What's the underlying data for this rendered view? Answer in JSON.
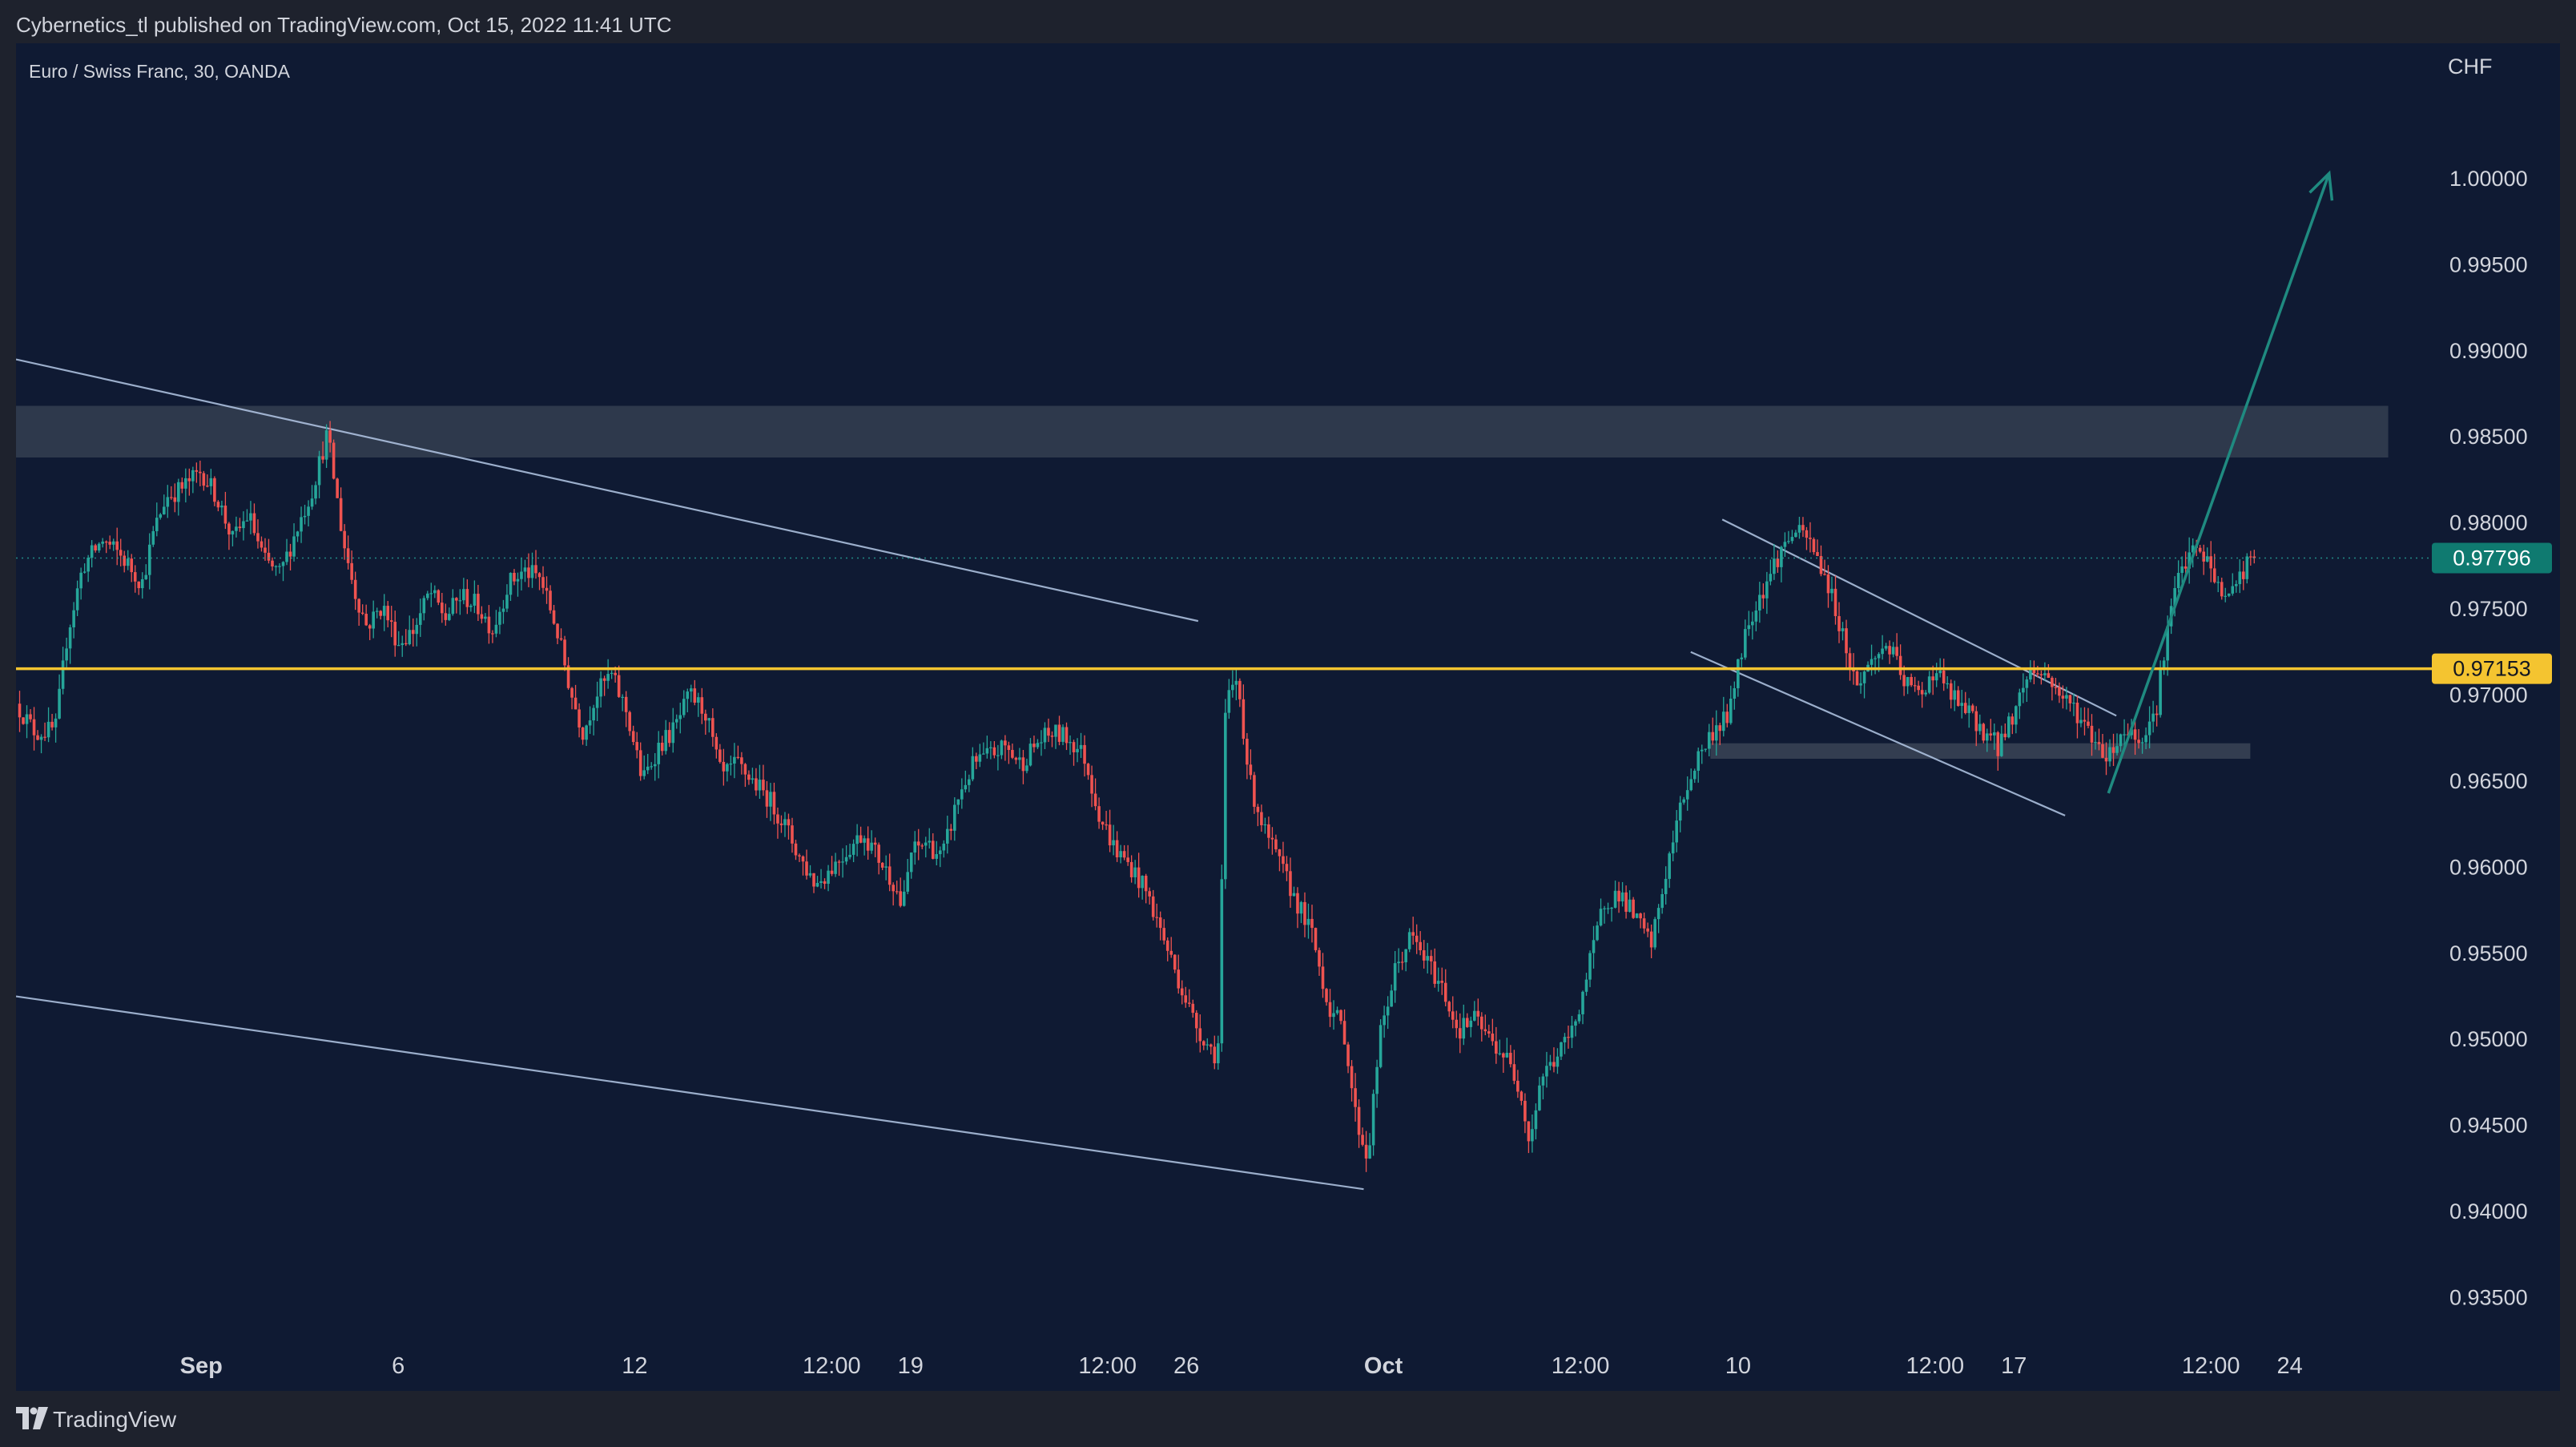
{
  "header": {
    "publish_line": "Cybernetics_tl published on TradingView.com, Oct 15, 2022 11:41 UTC"
  },
  "chart": {
    "symbol_title": "Euro / Swiss Franc, 30, OANDA",
    "currency_label": "CHF"
  },
  "footer": {
    "brand": "TradingView"
  },
  "colors": {
    "background": "#131722",
    "chart_bg": "#0f1a33",
    "bull": "#26a69a",
    "bear": "#ef5350",
    "support_line": "#f4c430",
    "last_price_badge": "#0f7a70",
    "zone_fill": "#3a4456",
    "trendline": "#b4c8e6",
    "arrow": "#1f8a80"
  },
  "chart_data": {
    "type": "candlestick",
    "title": "Euro / Swiss Franc, 30, OANDA",
    "ylabel": "CHF",
    "ylim": [
      0.932,
      1.006
    ],
    "y_ticks": [
      "1.00000",
      "0.99500",
      "0.99000",
      "0.98500",
      "0.98000",
      "0.97500",
      "0.97000",
      "0.96500",
      "0.96000",
      "0.95500",
      "0.95000",
      "0.94500",
      "0.94000",
      "0.93500"
    ],
    "y_tick_values": [
      1.0,
      0.995,
      0.99,
      0.985,
      0.98,
      0.975,
      0.97,
      0.965,
      0.96,
      0.955,
      0.95,
      0.945,
      0.94,
      0.935
    ],
    "x_ticks": [
      {
        "label": "Sep",
        "bold": true,
        "day": 0
      },
      {
        "label": "6",
        "bold": false,
        "day": 5
      },
      {
        "label": "12",
        "bold": false,
        "day": 11
      },
      {
        "label": "12:00",
        "bold": false,
        "day": 16
      },
      {
        "label": "19",
        "bold": false,
        "day": 18
      },
      {
        "label": "12:00",
        "bold": false,
        "day": 23
      },
      {
        "label": "26",
        "bold": false,
        "day": 25
      },
      {
        "label": "Oct",
        "bold": true,
        "day": 30
      },
      {
        "label": "12:00",
        "bold": false,
        "day": 35
      },
      {
        "label": "10",
        "bold": false,
        "day": 39
      },
      {
        "label": "12:00",
        "bold": false,
        "day": 44
      },
      {
        "label": "17",
        "bold": false,
        "day": 46
      },
      {
        "label": "12:00",
        "bold": false,
        "day": 51
      },
      {
        "label": "24",
        "bold": false,
        "day": 53
      }
    ],
    "x_range_days": [
      -4.7,
      56.2
    ],
    "price_path": [
      [
        -4.7,
        0.9695
      ],
      [
        -4.2,
        0.9678
      ],
      [
        -3.7,
        0.968
      ],
      [
        -3.4,
        0.9735
      ],
      [
        -3.0,
        0.9775
      ],
      [
        -2.5,
        0.979
      ],
      [
        -2.0,
        0.978
      ],
      [
        -1.5,
        0.9765
      ],
      [
        -1.2,
        0.9795
      ],
      [
        -0.9,
        0.9815
      ],
      [
        -0.5,
        0.982
      ],
      [
        0.0,
        0.983
      ],
      [
        0.4,
        0.9815
      ],
      [
        0.8,
        0.979
      ],
      [
        1.2,
        0.9805
      ],
      [
        1.6,
        0.9778
      ],
      [
        2.0,
        0.977
      ],
      [
        2.4,
        0.9795
      ],
      [
        2.8,
        0.9818
      ],
      [
        3.2,
        0.9852
      ],
      [
        3.6,
        0.979
      ],
      [
        3.9,
        0.976
      ],
      [
        4.2,
        0.974
      ],
      [
        4.6,
        0.9752
      ],
      [
        5.0,
        0.973
      ],
      [
        5.4,
        0.9738
      ],
      [
        5.8,
        0.976
      ],
      [
        6.2,
        0.9745
      ],
      [
        6.6,
        0.9758
      ],
      [
        7.0,
        0.9752
      ],
      [
        7.4,
        0.9738
      ],
      [
        7.8,
        0.9765
      ],
      [
        8.2,
        0.9772
      ],
      [
        8.6,
        0.9768
      ],
      [
        9.0,
        0.974
      ],
      [
        9.4,
        0.97
      ],
      [
        9.7,
        0.9678
      ],
      [
        10.0,
        0.97
      ],
      [
        10.4,
        0.9712
      ],
      [
        10.8,
        0.969
      ],
      [
        11.2,
        0.965
      ],
      [
        11.6,
        0.967
      ],
      [
        12.0,
        0.968
      ],
      [
        12.4,
        0.97
      ],
      [
        12.8,
        0.969
      ],
      [
        13.2,
        0.9652
      ],
      [
        13.6,
        0.966
      ],
      [
        14.0,
        0.965
      ],
      [
        14.4,
        0.964
      ],
      [
        14.8,
        0.9625
      ],
      [
        15.2,
        0.9605
      ],
      [
        15.6,
        0.959
      ],
      [
        16.0,
        0.96
      ],
      [
        16.4,
        0.961
      ],
      [
        16.8,
        0.962
      ],
      [
        17.2,
        0.9605
      ],
      [
        17.6,
        0.959
      ],
      [
        17.8,
        0.9575
      ],
      [
        18.0,
        0.9608
      ],
      [
        18.4,
        0.9615
      ],
      [
        18.8,
        0.9605
      ],
      [
        19.2,
        0.964
      ],
      [
        19.6,
        0.966
      ],
      [
        20.0,
        0.9665
      ],
      [
        20.4,
        0.967
      ],
      [
        20.8,
        0.966
      ],
      [
        21.2,
        0.9672
      ],
      [
        21.6,
        0.9678
      ],
      [
        22.0,
        0.9675
      ],
      [
        22.4,
        0.9665
      ],
      [
        22.8,
        0.963
      ],
      [
        23.2,
        0.961
      ],
      [
        23.6,
        0.96
      ],
      [
        24.0,
        0.9585
      ],
      [
        24.4,
        0.956
      ],
      [
        24.8,
        0.9535
      ],
      [
        25.2,
        0.951
      ],
      [
        25.6,
        0.9495
      ],
      [
        25.8,
        0.949
      ],
      [
        26.0,
        0.9695
      ],
      [
        26.3,
        0.971
      ],
      [
        26.6,
        0.965
      ],
      [
        27.0,
        0.962
      ],
      [
        27.4,
        0.96
      ],
      [
        27.8,
        0.958
      ],
      [
        28.2,
        0.956
      ],
      [
        28.6,
        0.952
      ],
      [
        29.0,
        0.9505
      ],
      [
        29.3,
        0.9455
      ],
      [
        29.6,
        0.943
      ],
      [
        29.9,
        0.95
      ],
      [
        30.3,
        0.954
      ],
      [
        30.7,
        0.956
      ],
      [
        31.1,
        0.9545
      ],
      [
        31.5,
        0.953
      ],
      [
        31.9,
        0.9505
      ],
      [
        32.3,
        0.9512
      ],
      [
        32.7,
        0.95
      ],
      [
        33.1,
        0.949
      ],
      [
        33.5,
        0.947
      ],
      [
        33.7,
        0.944
      ],
      [
        34.0,
        0.9478
      ],
      [
        34.4,
        0.949
      ],
      [
        34.8,
        0.9505
      ],
      [
        35.2,
        0.954
      ],
      [
        35.6,
        0.958
      ],
      [
        36.0,
        0.9585
      ],
      [
        36.4,
        0.957
      ],
      [
        36.8,
        0.9555
      ],
      [
        37.2,
        0.96
      ],
      [
        37.6,
        0.964
      ],
      [
        38.0,
        0.9665
      ],
      [
        38.4,
        0.968
      ],
      [
        38.8,
        0.969
      ],
      [
        39.0,
        0.972
      ],
      [
        39.3,
        0.9745
      ],
      [
        39.6,
        0.976
      ],
      [
        40.0,
        0.978
      ],
      [
        40.4,
        0.9795
      ],
      [
        40.8,
        0.979
      ],
      [
        41.2,
        0.977
      ],
      [
        41.6,
        0.974
      ],
      [
        42.0,
        0.9705
      ],
      [
        42.4,
        0.972
      ],
      [
        42.8,
        0.973
      ],
      [
        43.2,
        0.9708
      ],
      [
        43.6,
        0.97
      ],
      [
        44.0,
        0.9715
      ],
      [
        44.4,
        0.97
      ],
      [
        44.8,
        0.969
      ],
      [
        45.2,
        0.968
      ],
      [
        45.6,
        0.967
      ],
      [
        46.0,
        0.969
      ],
      [
        46.4,
        0.9715
      ],
      [
        46.8,
        0.9712
      ],
      [
        47.2,
        0.97
      ],
      [
        47.6,
        0.969
      ],
      [
        48.0,
        0.9675
      ],
      [
        48.4,
        0.9665
      ],
      [
        48.8,
        0.968
      ],
      [
        49.2,
        0.9675
      ],
      [
        49.6,
        0.969
      ],
      [
        49.9,
        0.974
      ],
      [
        50.2,
        0.977
      ],
      [
        50.6,
        0.9785
      ],
      [
        51.0,
        0.9775
      ],
      [
        51.3,
        0.9755
      ],
      [
        51.7,
        0.9768
      ],
      [
        52.1,
        0.9782
      ]
    ],
    "last_price": 0.97796,
    "last_price_label": "0.97796",
    "support_level": 0.97153,
    "support_label": "0.97153",
    "zones": [
      {
        "day_start": -4.7,
        "day_end": 55.5,
        "y_high": 0.9868,
        "y_low": 0.9838
      },
      {
        "day_start": 38.3,
        "day_end": 52.0,
        "y_high": 0.9672,
        "y_low": 0.9663
      }
    ],
    "trendlines": [
      {
        "day1": -4.7,
        "y1": 0.9895,
        "day2": 25.3,
        "y2": 0.9743
      },
      {
        "day1": -4.7,
        "y1": 0.9525,
        "day2": 29.5,
        "y2": 0.9413
      },
      {
        "day1": 38.6,
        "y1": 0.9802,
        "day2": 48.6,
        "y2": 0.9688
      },
      {
        "day1": 37.8,
        "y1": 0.9725,
        "day2": 47.3,
        "y2": 0.963
      }
    ],
    "arrow": {
      "day1": 48.4,
      "y1": 0.9643,
      "day2": 54.0,
      "y2": 1.0003
    },
    "grid": false,
    "legend": "none"
  }
}
